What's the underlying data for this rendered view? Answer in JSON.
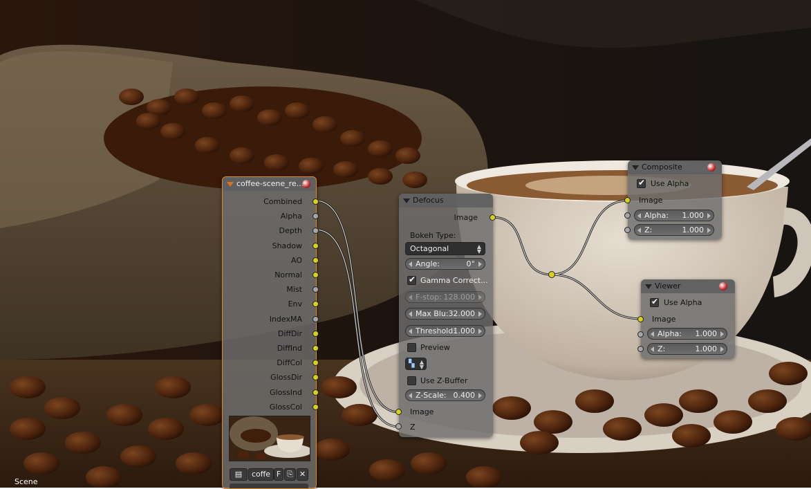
{
  "nodes": {
    "render_layers": {
      "title": "coffee-scene_re...",
      "outputs": [
        "Combined",
        "Alpha",
        "Depth",
        "Shadow",
        "AO",
        "Normal",
        "Mist",
        "Env",
        "IndexMA",
        "DiffDir",
        "DiffInd",
        "DiffCol",
        "GlossDir",
        "GlossInd",
        "GlossCol"
      ],
      "scene_field": "coffe",
      "fake_user_label": "F"
    },
    "defocus": {
      "title": "Defocus",
      "output_image": "Image",
      "bokeh_label": "Bokeh Type:",
      "bokeh_value": "Octagonal",
      "angle_label": "Angle:",
      "angle_value": "0°",
      "gamma_label": "Gamma Correct...",
      "fstop_label": "F-stop:",
      "fstop_value": "128.000",
      "maxblur_label": "Max Blu:",
      "maxblur_value": "32.000",
      "threshold_label": "Threshold:",
      "threshold_value": "1.000",
      "preview_label": "Preview",
      "zbuffer_label": "Use Z-Buffer",
      "zscale_label": "Z-Scale:",
      "zscale_value": "0.400",
      "input_image": "Image",
      "input_z": "Z"
    },
    "composite": {
      "title": "Composite",
      "use_alpha_label": "Use Alpha",
      "input_image": "Image",
      "alpha_label": "Alpha:",
      "alpha_value": "1.000",
      "z_label": "Z:",
      "z_value": "1.000"
    },
    "viewer": {
      "title": "Viewer",
      "use_alpha_label": "Use Alpha",
      "input_image": "Image",
      "alpha_label": "Alpha:",
      "alpha_value": "1.000",
      "z_label": "Z:",
      "z_value": "1.000"
    }
  },
  "footer": {
    "scene_label": "Scene"
  },
  "colors": {
    "socket_color": "#d7d11e",
    "socket_value": "#a6a6a6",
    "active_outline": "#e08a1e"
  }
}
